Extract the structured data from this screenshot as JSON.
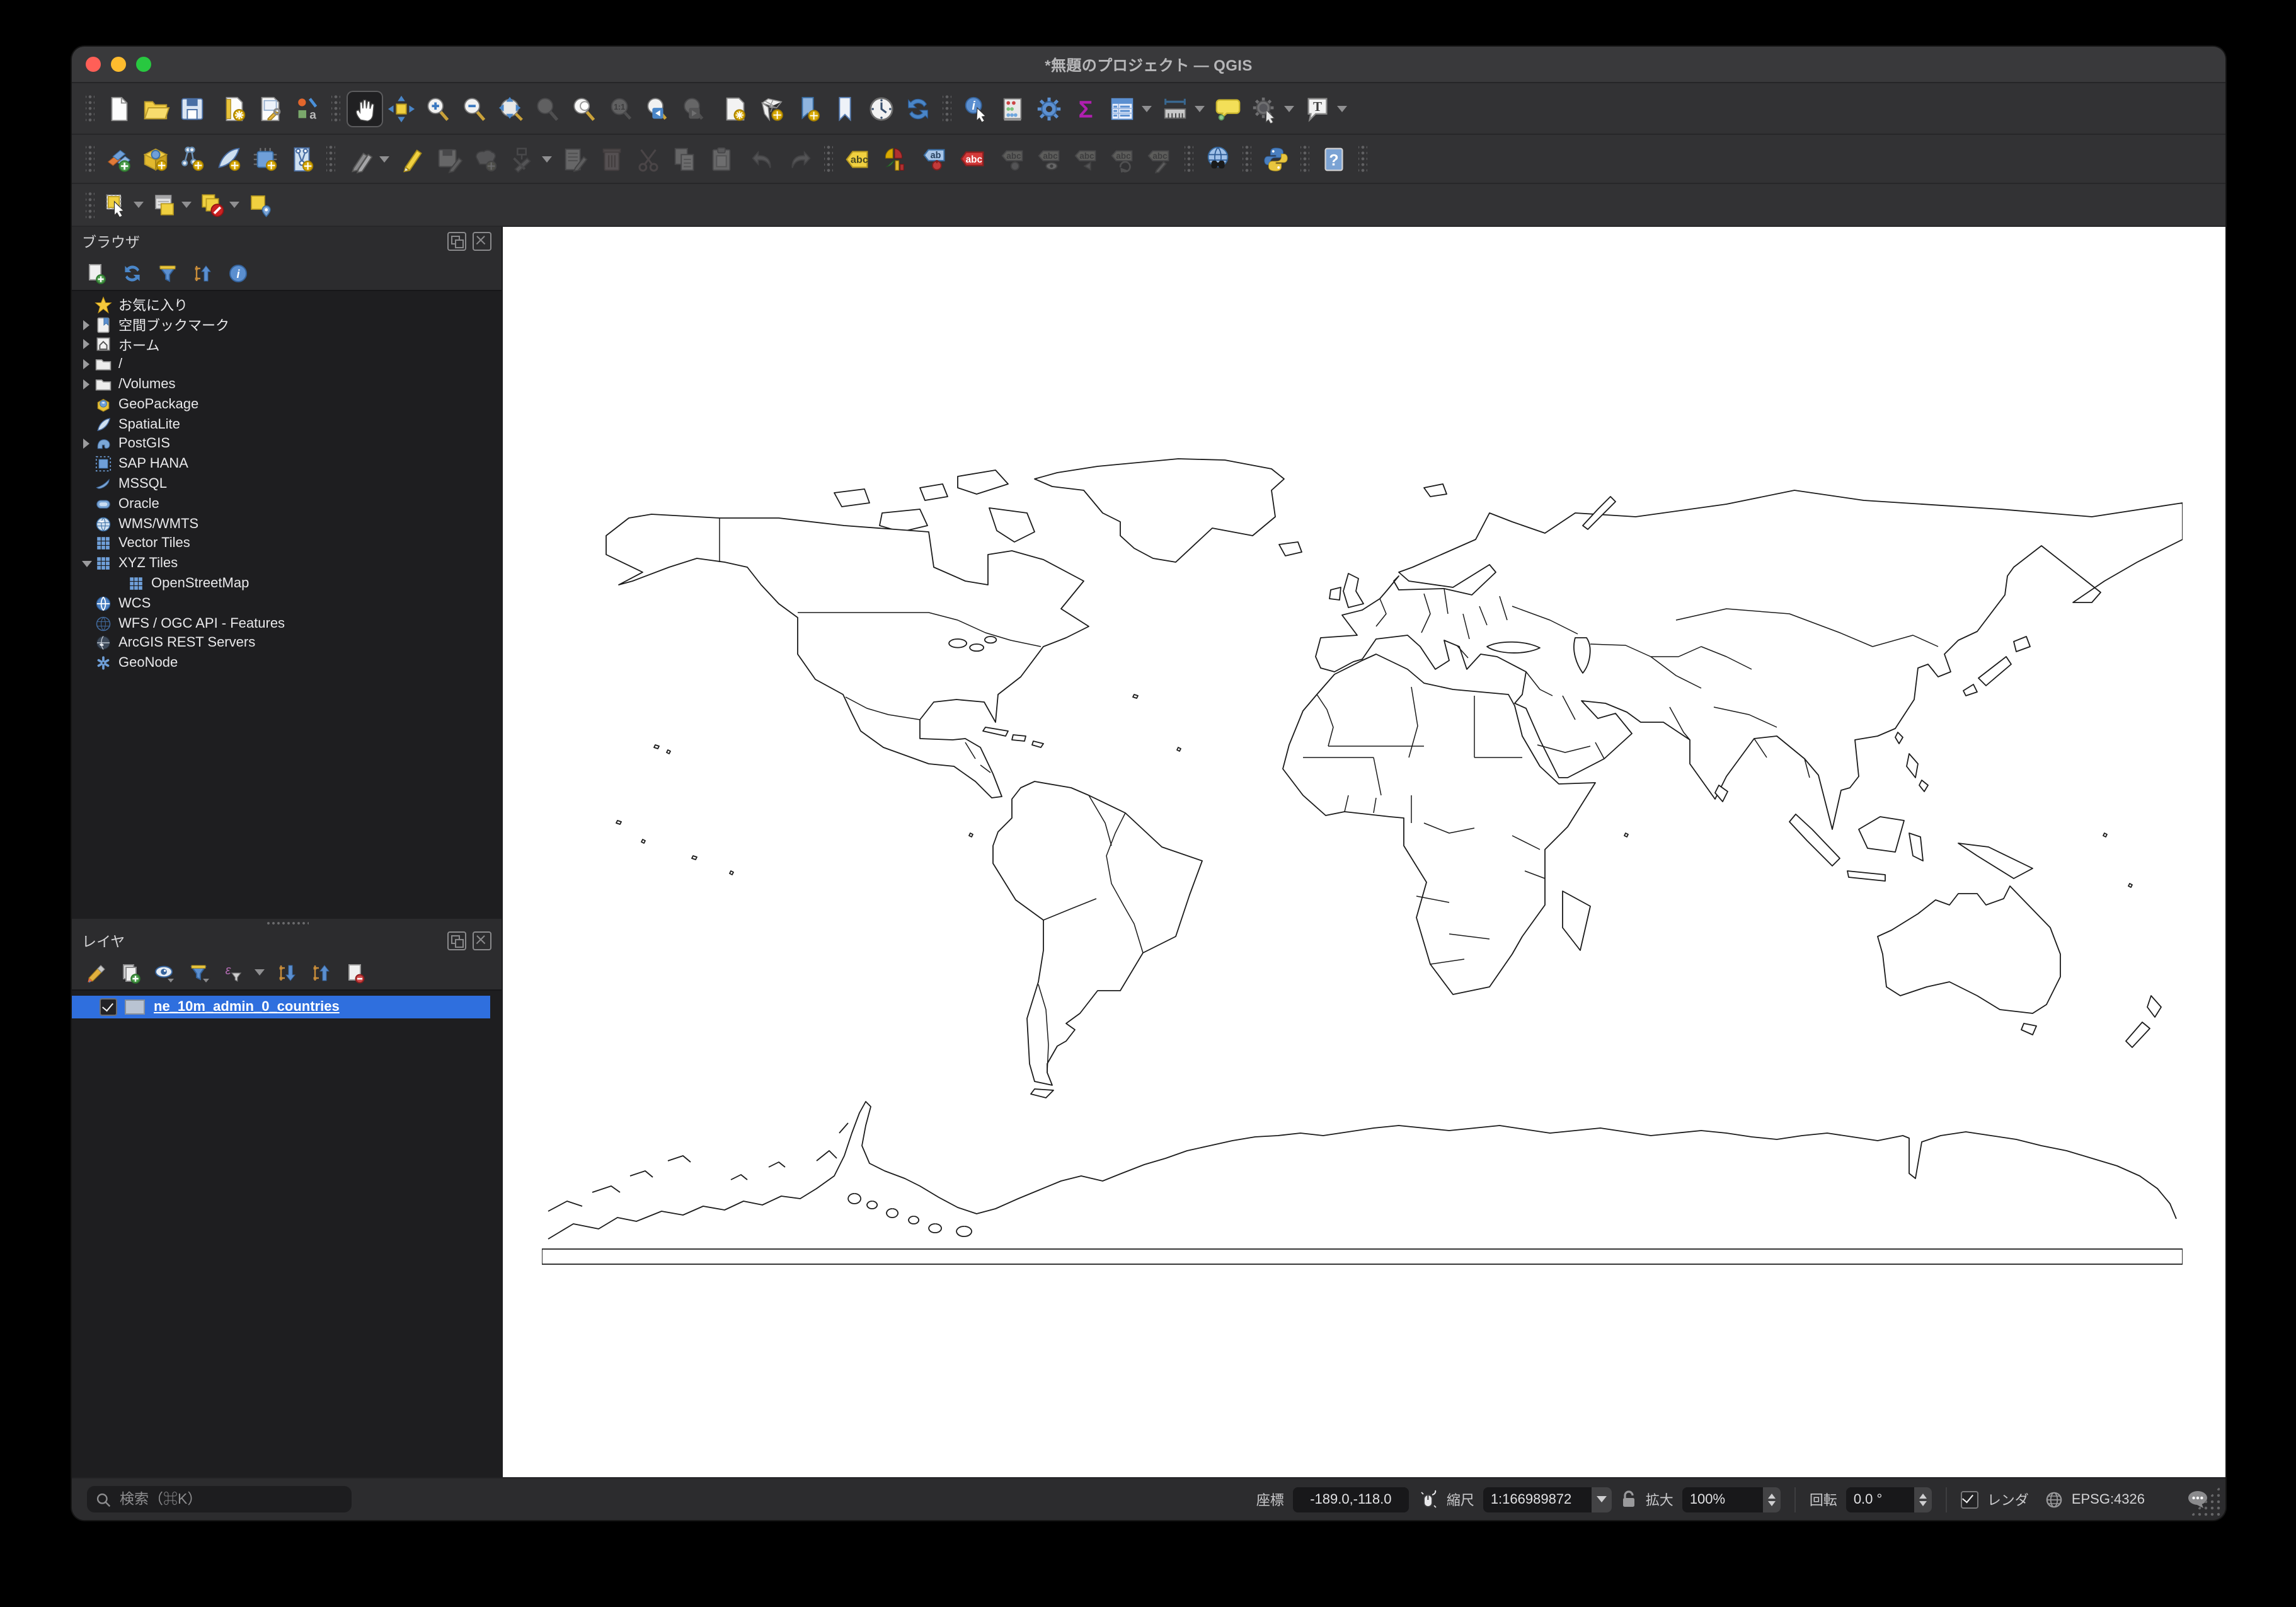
{
  "window": {
    "title": "*無題のプロジェクト — QGIS"
  },
  "browser": {
    "title": "ブラウザ",
    "items": [
      {
        "label": "お気に入り",
        "icon": "star",
        "level": 1,
        "arrow": "none"
      },
      {
        "label": "空間ブックマーク",
        "icon": "bookmark",
        "level": 1,
        "arrow": "closed"
      },
      {
        "label": "ホーム",
        "icon": "home",
        "level": 1,
        "arrow": "closed"
      },
      {
        "label": "/",
        "icon": "folder",
        "level": 1,
        "arrow": "closed"
      },
      {
        "label": "/Volumes",
        "icon": "folder",
        "level": 1,
        "arrow": "closed"
      },
      {
        "label": "GeoPackage",
        "icon": "geopackage",
        "level": 1,
        "arrow": "none"
      },
      {
        "label": "SpatiaLite",
        "icon": "spatialite",
        "level": 1,
        "arrow": "none"
      },
      {
        "label": "PostGIS",
        "icon": "postgis",
        "level": 1,
        "arrow": "closed"
      },
      {
        "label": "SAP HANA",
        "icon": "saphana",
        "level": 1,
        "arrow": "none"
      },
      {
        "label": "MSSQL",
        "icon": "mssql",
        "level": 1,
        "arrow": "none"
      },
      {
        "label": "Oracle",
        "icon": "oracle",
        "level": 1,
        "arrow": "none"
      },
      {
        "label": "WMS/WMTS",
        "icon": "wms",
        "level": 1,
        "arrow": "none"
      },
      {
        "label": "Vector Tiles",
        "icon": "tiles",
        "level": 1,
        "arrow": "none"
      },
      {
        "label": "XYZ Tiles",
        "icon": "tiles",
        "level": 1,
        "arrow": "open"
      },
      {
        "label": "OpenStreetMap",
        "icon": "tiles",
        "level": 2,
        "arrow": "none"
      },
      {
        "label": "WCS",
        "icon": "wcs",
        "level": 1,
        "arrow": "none"
      },
      {
        "label": "WFS / OGC API - Features",
        "icon": "wfs",
        "level": 1,
        "arrow": "none"
      },
      {
        "label": "ArcGIS REST Servers",
        "icon": "arcgis",
        "level": 1,
        "arrow": "none"
      },
      {
        "label": "GeoNode",
        "icon": "geonode",
        "level": 1,
        "arrow": "none"
      }
    ]
  },
  "layers": {
    "title": "レイヤ",
    "rows": [
      {
        "name": "ne_10m_admin_0_countries",
        "checked": true
      }
    ]
  },
  "statusbar": {
    "search_placeholder": "検索（⌘K）",
    "coordinate_label": "座標",
    "coordinate_value": "-189.0,-118.0",
    "scale_label": "縮尺",
    "scale_value": "1:166989872",
    "magnifier_label": "拡大",
    "magnifier_value": "100%",
    "rotation_label": "回転",
    "rotation_value": "0.0 °",
    "render_label": "レンダ",
    "crs": "EPSG:4326"
  },
  "icon_glyphs": {
    "identify_i": "i",
    "statistics_sigma": "Σ",
    "zoom_native": "1:1",
    "style_a": "a",
    "labeling_abc": "abc",
    "pin_ab": "ab",
    "highlight_abc": "abc",
    "text_t": "T",
    "help_q": "?"
  },
  "colors": {
    "selection_blue": "#2f6fde",
    "toolbar_bg": "#323234",
    "panel_bg": "#2c2c2e",
    "tree_bg": "#1e1e20",
    "canvas": "#ffffff",
    "icon_yellow": "#f0d040",
    "icon_blue": "#5b8fd0"
  }
}
